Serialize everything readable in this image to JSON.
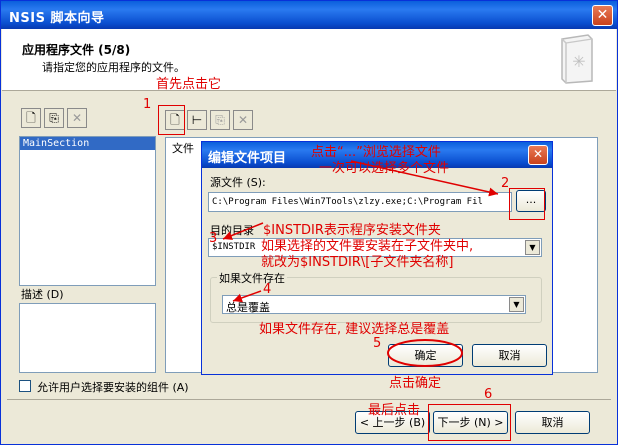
{
  "window": {
    "title": "NSIS 脚本向导",
    "close": "✕"
  },
  "header": {
    "step_title": "应用程序文件 (5/8)",
    "step_desc": "请指定您的应用程序的文件。"
  },
  "left_panel": {
    "tree_item": "MainSection",
    "desc_label": "描述 (D)"
  },
  "right_panel": {
    "col_file": "文件"
  },
  "toolbar_icons": {
    "left": [
      "new-icon",
      "copy-icon",
      "delete-icon"
    ],
    "right": [
      "add-file-icon",
      "add-dir-icon",
      "edit-icon",
      "remove-icon"
    ]
  },
  "checkbox_label": "允许用户选择要安装的组件 (A)",
  "footer": {
    "back": "< 上一步 (B)",
    "next": "下一步 (N) >",
    "cancel": "取消"
  },
  "dialog": {
    "title": "编辑文件项目",
    "close": "✕",
    "src_label": "源文件 (S):",
    "src_value": "C:\\Program Files\\Win7Tools\\zlzy.exe;C:\\Program Fil",
    "browse": "...",
    "dest_label": "目的目录",
    "dest_value": "$INSTDIR",
    "exists_label": "如果文件存在",
    "exists_value": "总是覆盖",
    "ok": "确定",
    "cancel": "取消"
  },
  "annotations": {
    "a1_num": "1",
    "a1_text": "首先点击它",
    "a2_line1": "点击“...”浏览选择文件",
    "a2_line2": "一次可以选择多个文件",
    "a2_num": "2",
    "a3_num": "3",
    "a3_line1": "$INSTDIR表示程序安装文件夹",
    "a3_line2": "如果选择的文件要安装在子文件夹中,",
    "a3_line3": "就改为$INSTDIR\\[子文件夹名称]",
    "a4_num": "4",
    "a4_text": "如果文件存在, 建议选择总是覆盖",
    "a5_num": "5",
    "a5_text": "点击确定",
    "a6_text": "最后点击",
    "a6_num": "6"
  },
  "colors": {
    "annotation": "#e00000",
    "titlebar": "#0a5fdc",
    "selection": "#316ac5"
  }
}
